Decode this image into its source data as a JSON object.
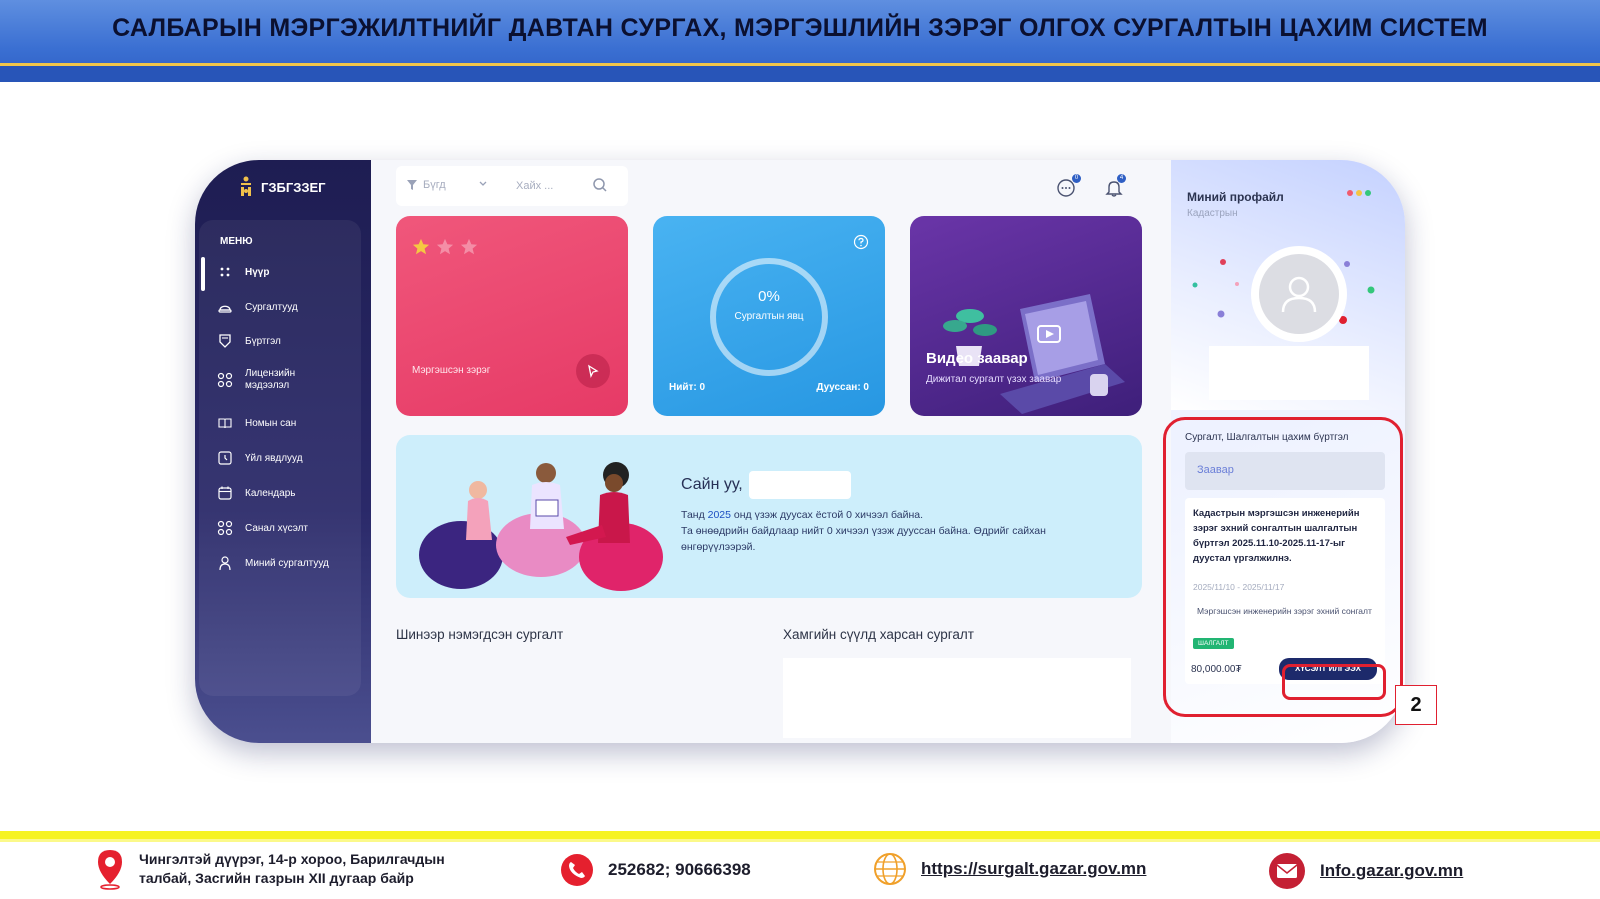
{
  "banner": {
    "title": "САЛБАРЫН МЭРГЭЖИЛТНИЙГ ДАВТАН СУРГАХ, МЭРГЭШЛИЙН ЗЭРЭГ ОЛГОХ СУРГАЛТЫН ЦАХИМ СИСТЕМ"
  },
  "app": {
    "logo_text": "ГЗБГЗЗЕГ",
    "menu_heading": "МЕНЮ",
    "menu": [
      {
        "label": "Нүүр",
        "icon": "grid-dots-icon",
        "active": true
      },
      {
        "label": "Сургалтууд",
        "icon": "hat-icon"
      },
      {
        "label": "Бүртгэл",
        "icon": "badge-icon"
      },
      {
        "label": "Лицензийн мэдээлэл",
        "icon": "apps-icon"
      },
      {
        "label": "Номын сан",
        "icon": "book-icon"
      },
      {
        "label": "Үйл явдлууд",
        "icon": "event-icon"
      },
      {
        "label": "Календарь",
        "icon": "calendar-icon"
      },
      {
        "label": "Санал хүсэлт",
        "icon": "feedback-icon"
      },
      {
        "label": "Миний сургалтууд",
        "icon": "user-icon"
      }
    ]
  },
  "topbar": {
    "filter_label": "Бүгд",
    "search_placeholder": "Хайх ...",
    "chat_badge": "0",
    "notif_badge": "4"
  },
  "cards": {
    "pink": {
      "label": "Мэргэшсэн зэрэг",
      "stars_filled": 1,
      "stars_total": 3
    },
    "blue": {
      "percent": "0%",
      "label": "Сургалтын явц",
      "total": "Нийт: 0",
      "done": "Дууссан: 0"
    },
    "purple": {
      "title": "Видео заавар",
      "subtitle": "Дижитал сургалт үзэх заавар"
    }
  },
  "welcome": {
    "greeting": "Сайн уу,",
    "line1_pre": "Танд ",
    "line1_year": "2025",
    "line1_post": " онд үзэж дуусах ёстой 0 хичээл байна.",
    "line2": "Та өнөөдрийн байдлаар нийт 0 хичээл үзэж дууссан байна. Өдрийг сайхан өнгөрүүлээрэй."
  },
  "sections": {
    "new_courses": "Шинээр нэмэгдсэн сургалт",
    "recent_courses": "Хамгийн сүүлд харсан сургалт"
  },
  "profile": {
    "title": "Миний профайл",
    "subtitle": "Кадастрын"
  },
  "registration": {
    "title": "Сургалт, Шалгалтын цахим бүртгэл",
    "tab": "Заавар",
    "description": "Кадастрын мэргэшсэн инженерийн зэрэг эхний сонгалтын шалгалтын бүртгэл 2025.11.10-2025.11-17-ыг дуустал үргэлжилнэ.",
    "dates": "2025/11/10 - 2025/11/17",
    "course": "Мэргэшсэн инженерийн зэрэг эхний сонгалт",
    "tag": "ШАЛГАЛТ",
    "price": "80,000.00₮",
    "button": "ХҮСЭЛТ ИЛГЭЭХ"
  },
  "annotation": {
    "callout_number": "2"
  },
  "footer": {
    "address_line1": "Чингэлтэй дүүрэг, 14-р хороо, Барилгачдын",
    "address_line2": "талбай, Засгийн газрын XII дугаар байр",
    "phone": "252682; 90666398",
    "website": "https://surgalt.gazar.gov.mn",
    "email": "Info.gazar.gov.mn"
  },
  "colors": {
    "banner": "#3a6fd2",
    "sidebar": "#1e1d52",
    "highlight_red": "#e02030",
    "footer_yellow": "#f6f322"
  }
}
